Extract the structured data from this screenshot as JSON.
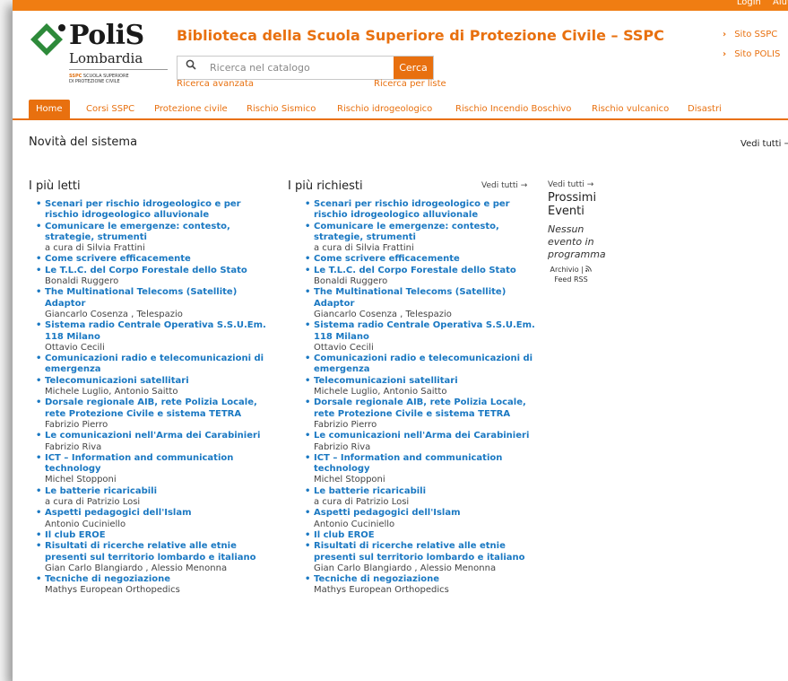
{
  "topbar": {
    "login": "Login",
    "aiuto": "Aiuto"
  },
  "logo": {
    "name": "PoliS",
    "region": "Lombardia",
    "sspc": "SSPC",
    "school_line1": "SCUOLA SUPERIORE",
    "school_line2": "DI PROTEZIONE CIVILE"
  },
  "header": {
    "title": "Biblioteca della Scuola Superiore di Protezione Civile – SSPC",
    "search_placeholder": "Ricerca nel catalogo",
    "search_button": "Cerca",
    "advanced": "Ricerca avanzata",
    "by_list": "Ricerca per liste",
    "site_links": [
      "Sito SSPC",
      "Sito POLIS"
    ]
  },
  "colors": {
    "accent": "#e8700f",
    "link": "#1a78c2",
    "logo_green": "#2d8a3a"
  },
  "icons": {
    "search": "search-icon",
    "rss": "rss-icon",
    "chevron": "chevron-right-icon"
  },
  "nav": [
    "Home",
    "Corsi SSPC",
    "Protezione civile",
    "Rischio Sismico",
    "Rischio idrogeologico",
    "Rischio Incendio Boschivo",
    "Rischio vulcanico",
    "Disastri"
  ],
  "novita": {
    "title": "Novità del sistema",
    "vedi": "Vedi tutti →"
  },
  "piu_letti": {
    "title": "I più letti",
    "items": [
      {
        "title": "Scenari per rischio idrogeologico e per rischio idrogeologico alluvionale",
        "author": ""
      },
      {
        "title": "Comunicare le emergenze: contesto, strategie, strumenti",
        "author": "a cura di Silvia Frattini"
      },
      {
        "title": "Come scrivere efficacemente",
        "author": ""
      },
      {
        "title": "Le T.L.C. del Corpo Forestale dello Stato",
        "author": "Bonaldi Ruggero"
      },
      {
        "title": "The Multinational Telecoms (Satellite) Adaptor",
        "author": "Giancarlo Cosenza , Telespazio"
      },
      {
        "title": "Sistema radio Centrale Operativa S.S.U.Em. 118 Milano",
        "author": "Ottavio Cecili"
      },
      {
        "title": "Comunicazioni radio e telecomunicazioni di emergenza",
        "author": ""
      },
      {
        "title": "Telecomunicazioni satellitari",
        "author": "Michele Luglio, Antonio Saitto"
      },
      {
        "title": "Dorsale regionale AIB, rete Polizia Locale, rete Protezione Civile e sistema TETRA",
        "author": "Fabrizio Pierro"
      },
      {
        "title": "Le comunicazioni nell'Arma dei Carabinieri",
        "author": "Fabrizio Riva"
      },
      {
        "title": "ICT – Information and communication technology",
        "author": "Michel Stopponi"
      },
      {
        "title": "Le batterie ricaricabili",
        "author": "a cura di Patrizio Losi"
      },
      {
        "title": "Aspetti pedagogici dell'Islam",
        "author": "Antonio Cuciniello"
      },
      {
        "title": "Il club EROE",
        "author": ""
      },
      {
        "title": "Risultati di ricerche relative alle etnie presenti sul territorio lombardo e italiano",
        "author": "Gian Carlo Blangiardo , Alessio Menonna"
      },
      {
        "title": "Tecniche di negoziazione",
        "author": "Mathys European Orthopedics"
      }
    ]
  },
  "piu_richiesti": {
    "title": "I più richiesti",
    "vedi": "Vedi tutti →",
    "items": [
      {
        "title": "Scenari per rischio idrogeologico e per rischio idrogeologico alluvionale",
        "author": ""
      },
      {
        "title": "Comunicare le emergenze: contesto, strategie, strumenti",
        "author": "a cura di Silvia Frattini"
      },
      {
        "title": "Come scrivere efficacemente",
        "author": ""
      },
      {
        "title": "Le T.L.C. del Corpo Forestale dello Stato",
        "author": "Bonaldi Ruggero"
      },
      {
        "title": "The Multinational Telecoms (Satellite) Adaptor",
        "author": "Giancarlo Cosenza , Telespazio"
      },
      {
        "title": "Sistema radio Centrale Operativa S.S.U.Em. 118 Milano",
        "author": "Ottavio Cecili"
      },
      {
        "title": "Comunicazioni radio e telecomunicazioni di emergenza",
        "author": ""
      },
      {
        "title": "Telecomunicazioni satellitari",
        "author": "Michele Luglio, Antonio Saitto"
      },
      {
        "title": "Dorsale regionale AIB, rete Polizia Locale, rete Protezione Civile e sistema TETRA",
        "author": "Fabrizio Pierro"
      },
      {
        "title": "Le comunicazioni nell'Arma dei Carabinieri",
        "author": "Fabrizio Riva"
      },
      {
        "title": "ICT – Information and communication technology",
        "author": "Michel Stopponi"
      },
      {
        "title": "Le batterie ricaricabili",
        "author": "a cura di Patrizio Losi"
      },
      {
        "title": "Aspetti pedagogici dell'Islam",
        "author": "Antonio Cuciniello"
      },
      {
        "title": "Il club EROE",
        "author": ""
      },
      {
        "title": "Risultati di ricerche relative alle etnie presenti sul territorio lombardo e italiano",
        "author": "Gian Carlo Blangiardo , Alessio Menonna"
      },
      {
        "title": "Tecniche di negoziazione",
        "author": "Mathys European Orthopedics"
      }
    ]
  },
  "eventi": {
    "vedi": "Vedi tutti →",
    "title": "Prossimi Eventi",
    "none": "Nessun evento in programma",
    "archivio": "Archivio",
    "feed": "Feed RSS"
  }
}
